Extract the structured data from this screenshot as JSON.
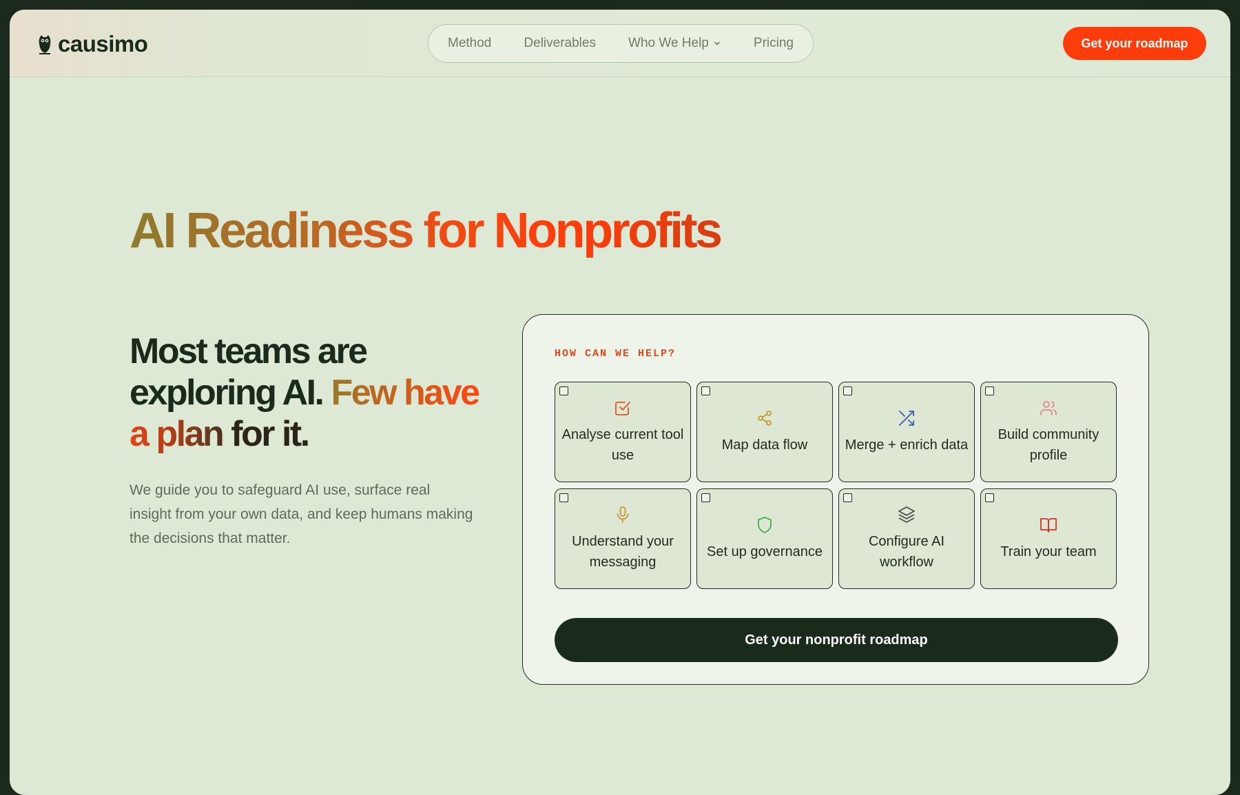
{
  "brand": {
    "name": "causimo"
  },
  "nav": {
    "items": [
      {
        "label": "Method"
      },
      {
        "label": "Deliverables"
      },
      {
        "label": "Who We Help"
      },
      {
        "label": "Pricing"
      }
    ],
    "cta": "Get your roadmap"
  },
  "hero": {
    "title": "AI Readiness for Nonprofits",
    "subhead": {
      "plain": "Most teams are exploring AI. ",
      "accent_a": "Few have",
      "accent_b": " a plan ",
      "tail": "for it."
    },
    "lead": "We guide you to safeguard AI use, surface real insight from your own data, and keep humans making the decisions that matter."
  },
  "card": {
    "label": "HOW CAN WE HELP?",
    "options": [
      {
        "label": "Analyse current tool use",
        "icon": "check-square-icon",
        "color": "#e0542a"
      },
      {
        "label": "Map data flow",
        "icon": "share-icon",
        "color": "#c9962e"
      },
      {
        "label": "Merge + enrich data",
        "icon": "shuffle-icon",
        "color": "#2f5fb0"
      },
      {
        "label": "Build community profile",
        "icon": "users-icon",
        "color": "#d98a8a"
      },
      {
        "label": "Understand your messaging",
        "icon": "microphone-icon",
        "color": "#c9962e"
      },
      {
        "label": "Set up governance",
        "icon": "shield-icon",
        "color": "#3fb24a"
      },
      {
        "label": "Configure AI workflow",
        "icon": "layers-icon",
        "color": "#4a4f4a"
      },
      {
        "label": "Train your team",
        "icon": "book-icon",
        "color": "#d8352a"
      }
    ],
    "cta": "Get your nonprofit roadmap"
  },
  "colors": {
    "accent": "#ff3d0a",
    "dark": "#1a2a1b",
    "background": "#dee9d5"
  }
}
